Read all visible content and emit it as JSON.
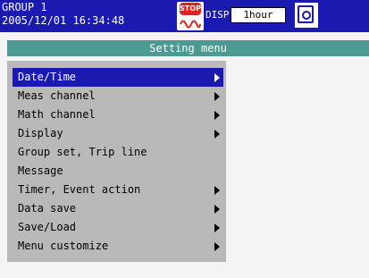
{
  "header": {
    "group_label": "GROUP 1",
    "datetime": "2005/12/01 16:34:48",
    "stop_icon_text": "STOP",
    "disp_label": "DISP",
    "time_div": "1hour",
    "icons": [
      "stop-icon",
      "cf-card-icon"
    ]
  },
  "title": "Setting menu",
  "menu": {
    "items": [
      {
        "label": "Date/Time",
        "submenu": true,
        "selected": true
      },
      {
        "label": "Meas channel",
        "submenu": true
      },
      {
        "label": "Math channel",
        "submenu": true
      },
      {
        "label": "Display",
        "submenu": true
      },
      {
        "label": "Group set, Trip line",
        "submenu": false
      },
      {
        "label": "Message",
        "submenu": false
      },
      {
        "label": "Timer, Event action",
        "submenu": true
      },
      {
        "label": "Data save",
        "submenu": true
      },
      {
        "label": "Save/Load",
        "submenu": true
      },
      {
        "label": "Menu customize",
        "submenu": true
      }
    ]
  },
  "colors": {
    "header_bg": "#1a1ab0",
    "title_bg": "#4c9a92",
    "menu_bg": "#b9b9b9",
    "selected_bg": "#1a1ab0",
    "stop_red": "#d8241c"
  }
}
